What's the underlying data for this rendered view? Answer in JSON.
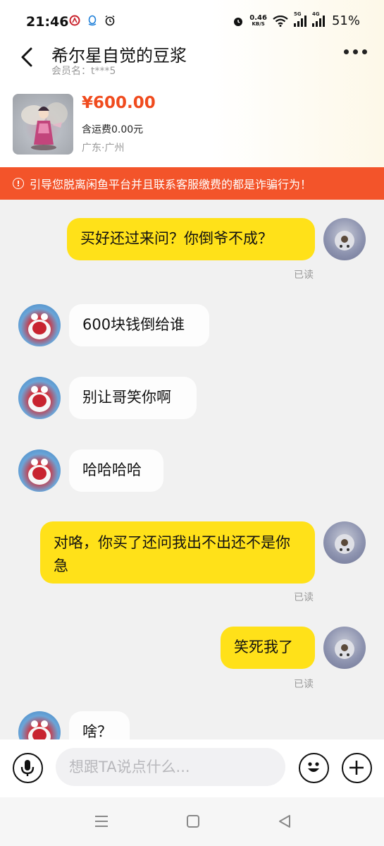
{
  "status_bar": {
    "time": "21:46",
    "net_speed_value": "0.46",
    "net_speed_unit": "KB/S",
    "signal_1_tag": "5G",
    "signal_2_tag": "4G",
    "battery": "51%"
  },
  "nav": {
    "title": "希尔星自觉的豆浆",
    "subtitle": "会员名：t***5"
  },
  "product": {
    "price": "¥600.00",
    "shipping": "含运费0.00元",
    "location": "广东·广州"
  },
  "warning": {
    "icon": "!",
    "text": "引导您脱离闲鱼平台并且联系客服缴费的都是诈骗行为！"
  },
  "messages": [
    {
      "from": "me",
      "text": "买好还过来问？你倒爷不成？",
      "status": "已读"
    },
    {
      "from": "other",
      "text": "600块钱倒给谁"
    },
    {
      "from": "other",
      "text": "别让哥笑你啊"
    },
    {
      "from": "other",
      "text": "哈哈哈哈"
    },
    {
      "from": "me",
      "text": "对咯，你买了还问我出不出还不是你急",
      "status": "已读"
    },
    {
      "from": "me",
      "text": "笑死我了",
      "status": "已读"
    },
    {
      "from": "other",
      "text": "啥？"
    }
  ],
  "input": {
    "placeholder": "想跟TA说点什么..."
  },
  "colors": {
    "accent_yellow": "#ffe119",
    "price_orange": "#f04b1e",
    "warning_bg": "#f3542a"
  }
}
